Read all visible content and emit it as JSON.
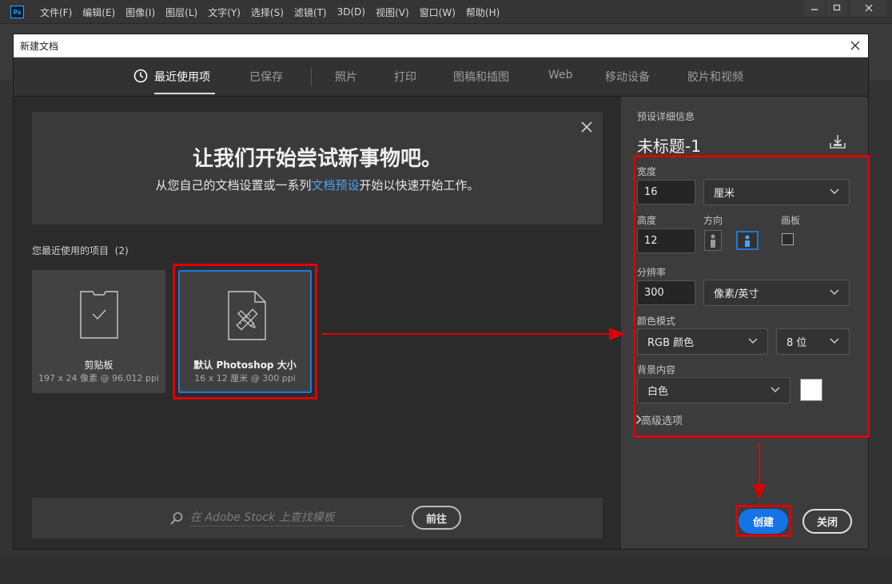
{
  "app": {
    "logo": "Ps",
    "menu": [
      "文件(F)",
      "编辑(E)",
      "图像(I)",
      "图层(L)",
      "文字(Y)",
      "选择(S)",
      "滤镜(T)",
      "3D(D)",
      "视图(V)",
      "窗口(W)",
      "帮助(H)"
    ],
    "window_controls": [
      "minimize-icon",
      "maximize-icon",
      "close-icon"
    ]
  },
  "dialog": {
    "title": "新建文档",
    "tabs": [
      {
        "label": "最近使用项",
        "active": true
      },
      {
        "label": "已保存"
      },
      {
        "label": "照片"
      },
      {
        "label": "打印"
      },
      {
        "label": "图稿和插图"
      },
      {
        "label": "Web"
      },
      {
        "label": "移动设备"
      },
      {
        "label": "胶片和视频"
      }
    ],
    "banner": {
      "title": "让我们开始尝试新事物吧。",
      "sub_before": "从您自己的文档设置或一系列",
      "sub_link": "文档预设",
      "sub_after": "开始以快速开始工作。"
    },
    "recent": {
      "label": "您最近使用的项目",
      "count": "(2)",
      "items": [
        {
          "name": "剪贴板",
          "meta": "197 x 24 像素 @ 96.012 ppi"
        },
        {
          "name": "默认 Photoshop 大小",
          "meta": "16 x 12 厘米 @ 300 ppi"
        }
      ]
    },
    "stock": {
      "placeholder": "在 Adobe Stock 上查找模板",
      "go_label": "前往"
    },
    "preset": {
      "header": "预设详细信息",
      "title": "未标题-1",
      "width_label": "宽度",
      "width_value": "16",
      "width_unit": "厘米",
      "height_label": "高度",
      "height_value": "12",
      "orientation_label": "方向",
      "artboard_label": "画板",
      "resolution_label": "分辨率",
      "resolution_value": "300",
      "resolution_unit": "像素/英寸",
      "color_mode_label": "颜色模式",
      "color_mode": "RGB 颜色",
      "bit_depth": "8 位",
      "bg_label": "背景内容",
      "bg_value": "白色",
      "advanced": "高级选项"
    },
    "buttons": {
      "create": "创建",
      "close": "关闭"
    }
  },
  "colors": {
    "accent": "#1473e6",
    "highlight": "#dd0000",
    "link": "#4ba3f1"
  }
}
